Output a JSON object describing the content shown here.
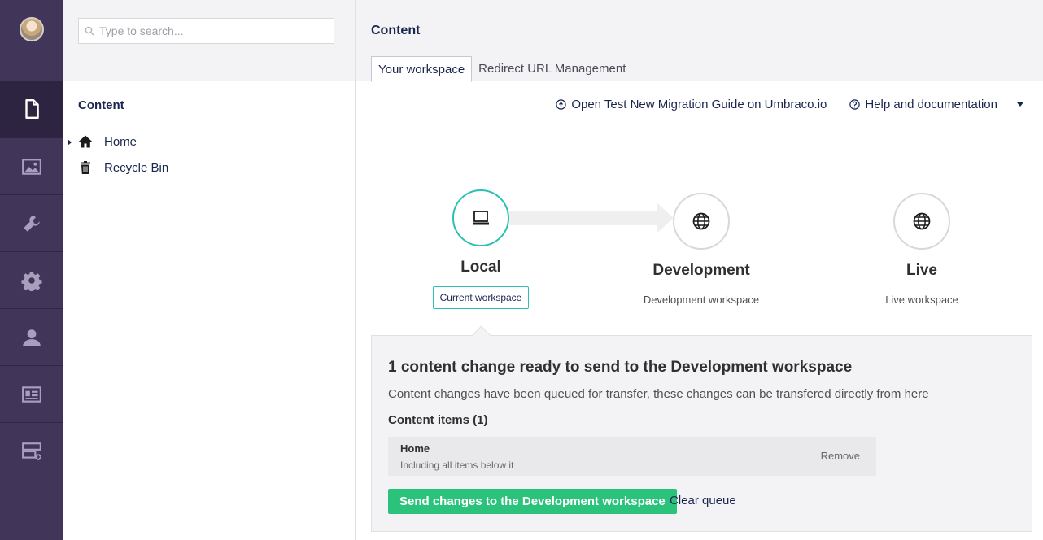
{
  "rail": {
    "items": [
      {
        "icon": "document-icon",
        "active": true
      },
      {
        "icon": "image-icon"
      },
      {
        "icon": "wrench-icon"
      },
      {
        "icon": "gear-icon"
      },
      {
        "icon": "user-icon"
      },
      {
        "icon": "id-card-icon"
      },
      {
        "icon": "forms-icon"
      }
    ]
  },
  "tree": {
    "search_placeholder": "Type to search...",
    "root_label": "Content",
    "nodes": [
      {
        "label": "Home",
        "icon": "home-icon",
        "has_children": true
      },
      {
        "label": "Recycle Bin",
        "icon": "trash-icon",
        "has_children": false
      }
    ]
  },
  "main": {
    "title": "Content",
    "tabs": [
      {
        "label": "Your workspace",
        "active": true
      },
      {
        "label": "Redirect URL Management",
        "active": false
      }
    ],
    "toolbar": {
      "guide_link": "Open Test New Migration Guide on Umbraco.io",
      "help_link": "Help and documentation"
    },
    "workspaces": [
      {
        "name": "Local",
        "badge": "Current workspace",
        "icon": "laptop-icon",
        "current": true
      },
      {
        "name": "Development",
        "sub": "Development workspace",
        "icon": "globe-icon"
      },
      {
        "name": "Live",
        "sub": "Live workspace",
        "icon": "globe-icon"
      }
    ],
    "queue": {
      "heading": "1 content change ready to send to the Development workspace",
      "description": "Content changes have been queued for transfer, these changes can be transfered directly from here",
      "items_heading": "Content items (1)",
      "items": [
        {
          "title": "Home",
          "subtitle": "Including all items below it",
          "remove_label": "Remove"
        }
      ],
      "send_button": "Send changes to the Development workspace",
      "clear_button": "Clear queue"
    }
  },
  "colors": {
    "rail_bg": "#413659",
    "accent_teal": "#2bc0b3",
    "success_green": "#2bc37c",
    "text_navy": "#1b264f"
  }
}
